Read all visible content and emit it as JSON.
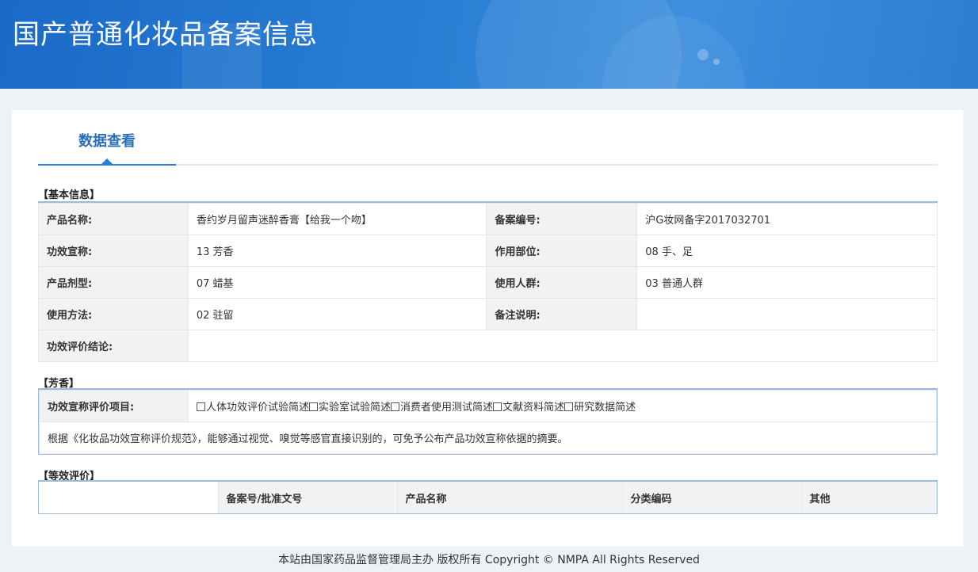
{
  "header": {
    "title": "国产普通化妆品备案信息"
  },
  "tabs": [
    {
      "label": "数据查看",
      "active": true
    }
  ],
  "basic": {
    "section_title": "【基本信息】",
    "rows": [
      {
        "l1": "产品名称:",
        "v1": "香约岁月留声迷醉香膏【给我一个吻】",
        "l2": "备案编号:",
        "v2": "沪G妆网备字2017032701"
      },
      {
        "l1": "功效宣称:",
        "v1": "13 芳香",
        "l2": "作用部位:",
        "v2": "08 手、足"
      },
      {
        "l1": "产品剂型:",
        "v1": "07 蜡基",
        "l2": "使用人群:",
        "v2": "03 普通人群"
      },
      {
        "l1": "使用方法:",
        "v1": "02 驻留",
        "l2": "备注说明:",
        "v2": ""
      }
    ],
    "conclusion_label": "功效评价结论:",
    "conclusion_value": ""
  },
  "fragrance": {
    "section_title": "【芳香】",
    "label": "功效宣称评价项目:",
    "options": [
      "人体功效评价试验简述",
      "实验室试验简述",
      "消费者使用测试简述",
      "文献资料简述",
      "研究数据简述"
    ],
    "note": "根据《化妆品功效宣称评价规范》，能够通过视觉、嗅觉等感官直接识别的，可免予公布产品功效宣称依据的摘要。"
  },
  "equivalent": {
    "section_title": "【等效评价】",
    "columns": [
      "",
      "备案号/批准文号",
      "产品名称",
      "分类编码",
      "其他"
    ]
  },
  "footer": {
    "text": "本站由国家药品监督管理局主办 版权所有 Copyright © NMPA All Rights Reserved"
  },
  "colors": {
    "header_blue": "#2a7fd4",
    "tab_text": "#2a6fb8",
    "border_blue": "#9fb9db"
  }
}
